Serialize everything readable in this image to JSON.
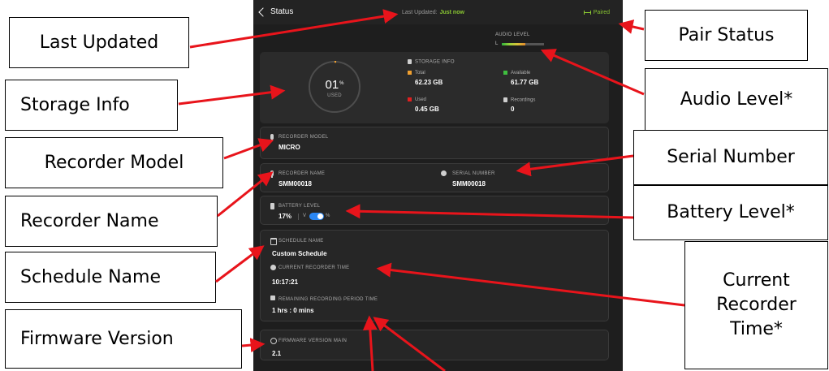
{
  "screen": {
    "back_label": "Status",
    "last_updated_label": "Last Updated:",
    "last_updated_value": "Just now",
    "pair_status": "Paired",
    "audio_level": {
      "title": "AUDIO LEVEL",
      "channel": "L",
      "level": 0.55
    },
    "storage": {
      "title": "STORAGE INFO",
      "used_percent": "01",
      "percent_sign": "%",
      "used_caption": "USED",
      "total_label": "Total",
      "total_value": "62.23 GB",
      "available_label": "Available",
      "available_value": "61.77 GB",
      "used_label": "Used",
      "used_value": "0.45 GB",
      "recordings_label": "Recordings",
      "recordings_value": "0"
    },
    "recorder_model": {
      "label": "RECORDER MODEL",
      "value": "MICRO"
    },
    "recorder_name": {
      "label": "RECORDER NAME",
      "value": "SMM00018"
    },
    "serial_number": {
      "label": "SERIAL NUMBER",
      "value": "SMM00018"
    },
    "battery": {
      "label": "BATTERY LEVEL",
      "value": "17%",
      "v_label": "V",
      "pct_label": "%"
    },
    "schedule": {
      "name_label": "SCHEDULE NAME",
      "name_value": "Custom Schedule",
      "time_label": "CURRENT RECORDER TIME",
      "time_value": "10:17:21",
      "remaining_label": "REMAINING RECORDING PERIOD TIME",
      "remaining_value": "1 hrs : 0 mins"
    },
    "firmware": {
      "label": "FIRMWARE VERSION MAIN",
      "value": "2.1"
    }
  },
  "callouts": {
    "last_updated": "Last Updated",
    "storage_info": "Storage Info",
    "recorder_model": "Recorder Model",
    "recorder_name": "Recorder Name",
    "schedule_name": "Schedule Name",
    "firmware_version": "Firmware Version",
    "pair_status": "Pair Status",
    "audio_level": "Audio Level*",
    "serial_number": "Serial Number",
    "battery_level": "Battery Level*",
    "current_time_line1": "Current",
    "current_time_line2": "Recorder",
    "current_time_line3": "Time*"
  },
  "colors": {
    "accent_green": "#8ac732",
    "storage_total": "#f0a030",
    "storage_available": "#3fbf3f",
    "storage_used": "#e02020",
    "toggle_blue": "#2a86f2",
    "arrow_red": "#e8141b"
  }
}
